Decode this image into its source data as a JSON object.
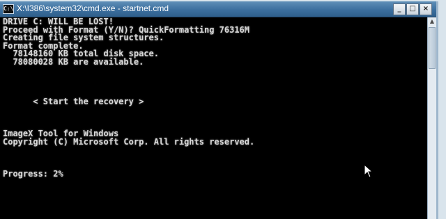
{
  "window": {
    "title": "X:\\I386\\system32\\cmd.exe - startnet.cmd",
    "icon_text": "C:\\",
    "buttons": {
      "minimize": "_",
      "maximize": "□",
      "close": "×"
    }
  },
  "console": {
    "lines": [
      "DRIVE C: WILL BE LOST!",
      "Proceed with Format (Y/N)? QuickFormatting 76316M",
      "Creating file system structures.",
      "Format complete.",
      "  78148160 KB total disk space.",
      "  78080028 KB are available.",
      "",
      "",
      "",
      "",
      "      < Start the recovery >",
      "",
      "",
      "",
      "ImageX Tool for Windows",
      "Copyright (C) Microsoft Corp. All rights reserved.",
      "",
      "",
      "",
      "Progress: 2%"
    ]
  },
  "scrollbar": {
    "up_arrow": "▲"
  },
  "icons": {
    "cursor": "mouse-pointer-icon",
    "console": "cmd-icon"
  },
  "colors": {
    "console_background": "#000000",
    "console_text": "#d8d8d8",
    "titlebar": "#3c6f9e"
  }
}
